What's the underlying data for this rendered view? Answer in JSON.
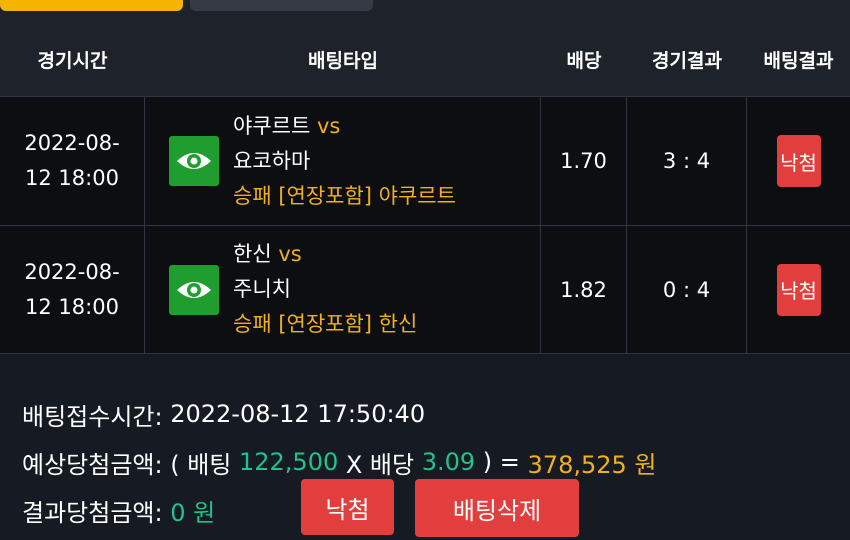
{
  "columns": [
    "경기시간",
    "배팅타입",
    "배당",
    "경기결과",
    "배팅결과"
  ],
  "rows": [
    {
      "date": "2022-08-",
      "time": "12 18:00",
      "team1": "야쿠르트",
      "vs": "vs",
      "team2": "요코하마",
      "pick": "승패 [연장포함] 야쿠르트",
      "odds": "1.70",
      "score": "3 : 4",
      "result": "낙첨"
    },
    {
      "date": "2022-08-",
      "time": "12 18:00",
      "team1": "한신",
      "vs": "vs",
      "team2": "주니치",
      "pick": "승패 [연장포함] 한신",
      "odds": "1.82",
      "score": "0 : 4",
      "result": "낙첨"
    }
  ],
  "summary": {
    "receipt_label": "배팅접수시간: ",
    "receipt_time": "2022-08-12 17:50:40",
    "expected_label": "예상당첨금액: ",
    "open_paren": "( 배팅 ",
    "bet_amount": "122,500",
    "times_label": " X 배당 ",
    "total_odds": "3.09",
    "equals": " ) = ",
    "expected_amount": "378,525 원",
    "result_label": "결과당첨금액: ",
    "result_amount": "0 원",
    "result_button": "낙첨",
    "delete_button": "배팅삭제"
  },
  "colors": {
    "accent_yellow": "#f2b01e",
    "green": "#23c28a",
    "red_button": "#e23e3e",
    "eye_button": "#1f9e2f"
  },
  "icons": [
    "eye-icon"
  ]
}
